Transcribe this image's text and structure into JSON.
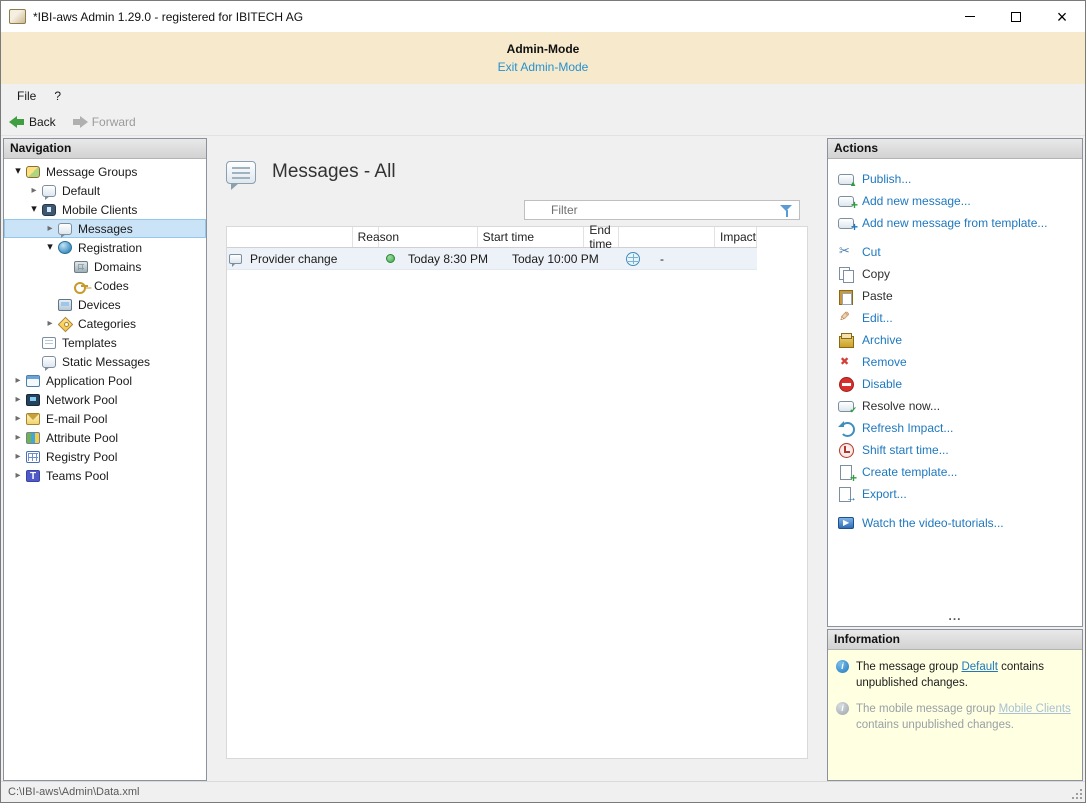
{
  "window": {
    "title": "*IBI-aws Admin 1.29.0 - registered for IBITECH AG"
  },
  "admin_banner": {
    "title": "Admin-Mode",
    "link": "Exit Admin-Mode"
  },
  "menu": {
    "items": [
      {
        "label": "File"
      },
      {
        "label": "?"
      }
    ]
  },
  "toolbar": {
    "back": "Back",
    "forward": "Forward"
  },
  "navigation": {
    "header": "Navigation",
    "tree": [
      {
        "label": "Message Groups",
        "level": 0,
        "chevron": "expanded",
        "icon": "message-groups-icon"
      },
      {
        "label": "Default",
        "level": 1,
        "chevron": "collapsed",
        "icon": "message-group-icon"
      },
      {
        "label": "Mobile Clients",
        "level": 1,
        "chevron": "expanded",
        "icon": "mobile-clients-icon"
      },
      {
        "label": "Messages",
        "level": 2,
        "chevron": "collapsed",
        "icon": "messages-icon",
        "selected": true
      },
      {
        "label": "Registration",
        "level": 2,
        "chevron": "expanded",
        "icon": "registration-icon"
      },
      {
        "label": "Domains",
        "level": 3,
        "chevron": "none",
        "icon": "domains-icon"
      },
      {
        "label": "Codes",
        "level": 3,
        "chevron": "none",
        "icon": "codes-icon"
      },
      {
        "label": "Devices",
        "level": 2,
        "chevron": "none",
        "icon": "devices-icon"
      },
      {
        "label": "Categories",
        "level": 2,
        "chevron": "collapsed",
        "icon": "categories-icon"
      },
      {
        "label": "Templates",
        "level": 1,
        "chevron": "none",
        "icon": "templates-icon"
      },
      {
        "label": "Static Messages",
        "level": 1,
        "chevron": "none",
        "icon": "static-messages-icon"
      },
      {
        "label": "Application Pool",
        "level": 0,
        "chevron": "collapsed",
        "icon": "application-pool-icon"
      },
      {
        "label": "Network Pool",
        "level": 0,
        "chevron": "collapsed",
        "icon": "network-pool-icon"
      },
      {
        "label": "E-mail Pool",
        "level": 0,
        "chevron": "collapsed",
        "icon": "email-pool-icon"
      },
      {
        "label": "Attribute Pool",
        "level": 0,
        "chevron": "collapsed",
        "icon": "attribute-pool-icon"
      },
      {
        "label": "Registry Pool",
        "level": 0,
        "chevron": "collapsed",
        "icon": "registry-pool-icon"
      },
      {
        "label": "Teams Pool",
        "level": 0,
        "chevron": "collapsed",
        "icon": "teams-pool-icon"
      }
    ]
  },
  "main": {
    "title": "Messages - All",
    "filter_placeholder": "Filter",
    "table": {
      "columns": [
        "",
        "Reason",
        "",
        "Start time",
        "End time",
        "",
        "Impact"
      ],
      "rows": [
        {
          "reason": "Provider change",
          "status": "active",
          "start": "Today 8:30 PM",
          "end": "Today 10:00 PM",
          "impact": "-"
        }
      ]
    }
  },
  "actions": {
    "header": "Actions",
    "overflow": "...",
    "items": [
      {
        "label": "Publish...",
        "icon": "publish-icon",
        "enabled": true
      },
      {
        "label": "Add new message...",
        "icon": "add-message-icon",
        "enabled": true
      },
      {
        "label": "Add new message from template...",
        "icon": "add-from-template-icon",
        "enabled": true
      },
      {
        "label": "Cut",
        "icon": "cut-icon",
        "enabled": true,
        "gap_before": true
      },
      {
        "label": "Copy",
        "icon": "copy-icon",
        "enabled": false
      },
      {
        "label": "Paste",
        "icon": "paste-icon",
        "enabled": false
      },
      {
        "label": "Edit...",
        "icon": "edit-icon",
        "enabled": true
      },
      {
        "label": "Archive",
        "icon": "archive-icon",
        "enabled": true
      },
      {
        "label": "Remove",
        "icon": "remove-icon",
        "enabled": true
      },
      {
        "label": "Disable",
        "icon": "disable-icon",
        "enabled": true
      },
      {
        "label": "Resolve now...",
        "icon": "resolve-icon",
        "enabled": false
      },
      {
        "label": "Refresh Impact...",
        "icon": "refresh-impact-icon",
        "enabled": true
      },
      {
        "label": "Shift start time...",
        "icon": "shift-start-icon",
        "enabled": true
      },
      {
        "label": "Create template...",
        "icon": "create-template-icon",
        "enabled": true
      },
      {
        "label": "Export...",
        "icon": "export-icon",
        "enabled": true
      },
      {
        "label": "Watch the video-tutorials...",
        "icon": "video-tutorials-icon",
        "enabled": true,
        "gap_before": true
      }
    ]
  },
  "information": {
    "header": "Information",
    "items": [
      {
        "prefix": "The message group ",
        "link": "Default",
        "suffix": " contains unpublished changes.",
        "muted": false
      },
      {
        "prefix": "The mobile message group ",
        "link": "Mobile Clients",
        "suffix": " contains unpublished changes.",
        "muted": true
      }
    ]
  },
  "statusbar": {
    "path": "C:\\IBI-aws\\Admin\\Data.xml"
  },
  "colors": {
    "action_link": "#1e78bf",
    "banner_bg": "#f7e9cc",
    "info_bg": "#ffffe1",
    "tree_selection": "#cbe3f7",
    "status_active_green": "#3fae49"
  }
}
